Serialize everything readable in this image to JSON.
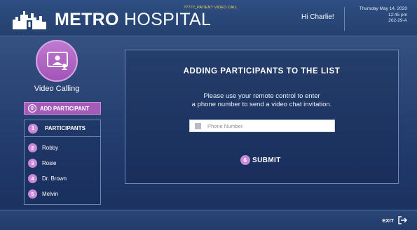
{
  "header": {
    "brand_bold": "METRO",
    "brand_light": " HOSPITAL",
    "tag": "?????_PATIENT VIDEO CALL",
    "greeting": "Hi Charlie!",
    "date": "Thursday May 14, 2020",
    "time": "12:45 pm",
    "room": "202-29-A"
  },
  "sidebar": {
    "feature_label": "Video Calling",
    "add_participant": {
      "number": "0",
      "label": "ADD PARTICIPANT"
    },
    "participants_header": {
      "number": "1",
      "label": "PARTICIPANTS"
    },
    "participants": [
      {
        "number": "2",
        "name": "Robby"
      },
      {
        "number": "3",
        "name": "Rosie"
      },
      {
        "number": "4",
        "name": "Dr. Brown"
      },
      {
        "number": "5",
        "name": "Melvin"
      }
    ]
  },
  "main": {
    "title": "ADDING PARTICIPANTS TO THE LIST",
    "instruction_line1": "Please use your remote control to enter",
    "instruction_line2": "a phone number to send a video chat invitation.",
    "phone_placeholder": "Phone Number",
    "phone_value": "",
    "submit": {
      "number": "6",
      "label": "SUBMIT"
    }
  },
  "footer": {
    "exit_label": "EXIT"
  },
  "colors": {
    "accent_purple": "#a35cb7",
    "badge_purple": "#c98ad9",
    "background_navy": "#24406f"
  },
  "icons": {
    "logo": "city-skyline-icon",
    "video_call": "video-call-icon",
    "phone_field": "phone-icon",
    "exit": "exit-icon"
  }
}
